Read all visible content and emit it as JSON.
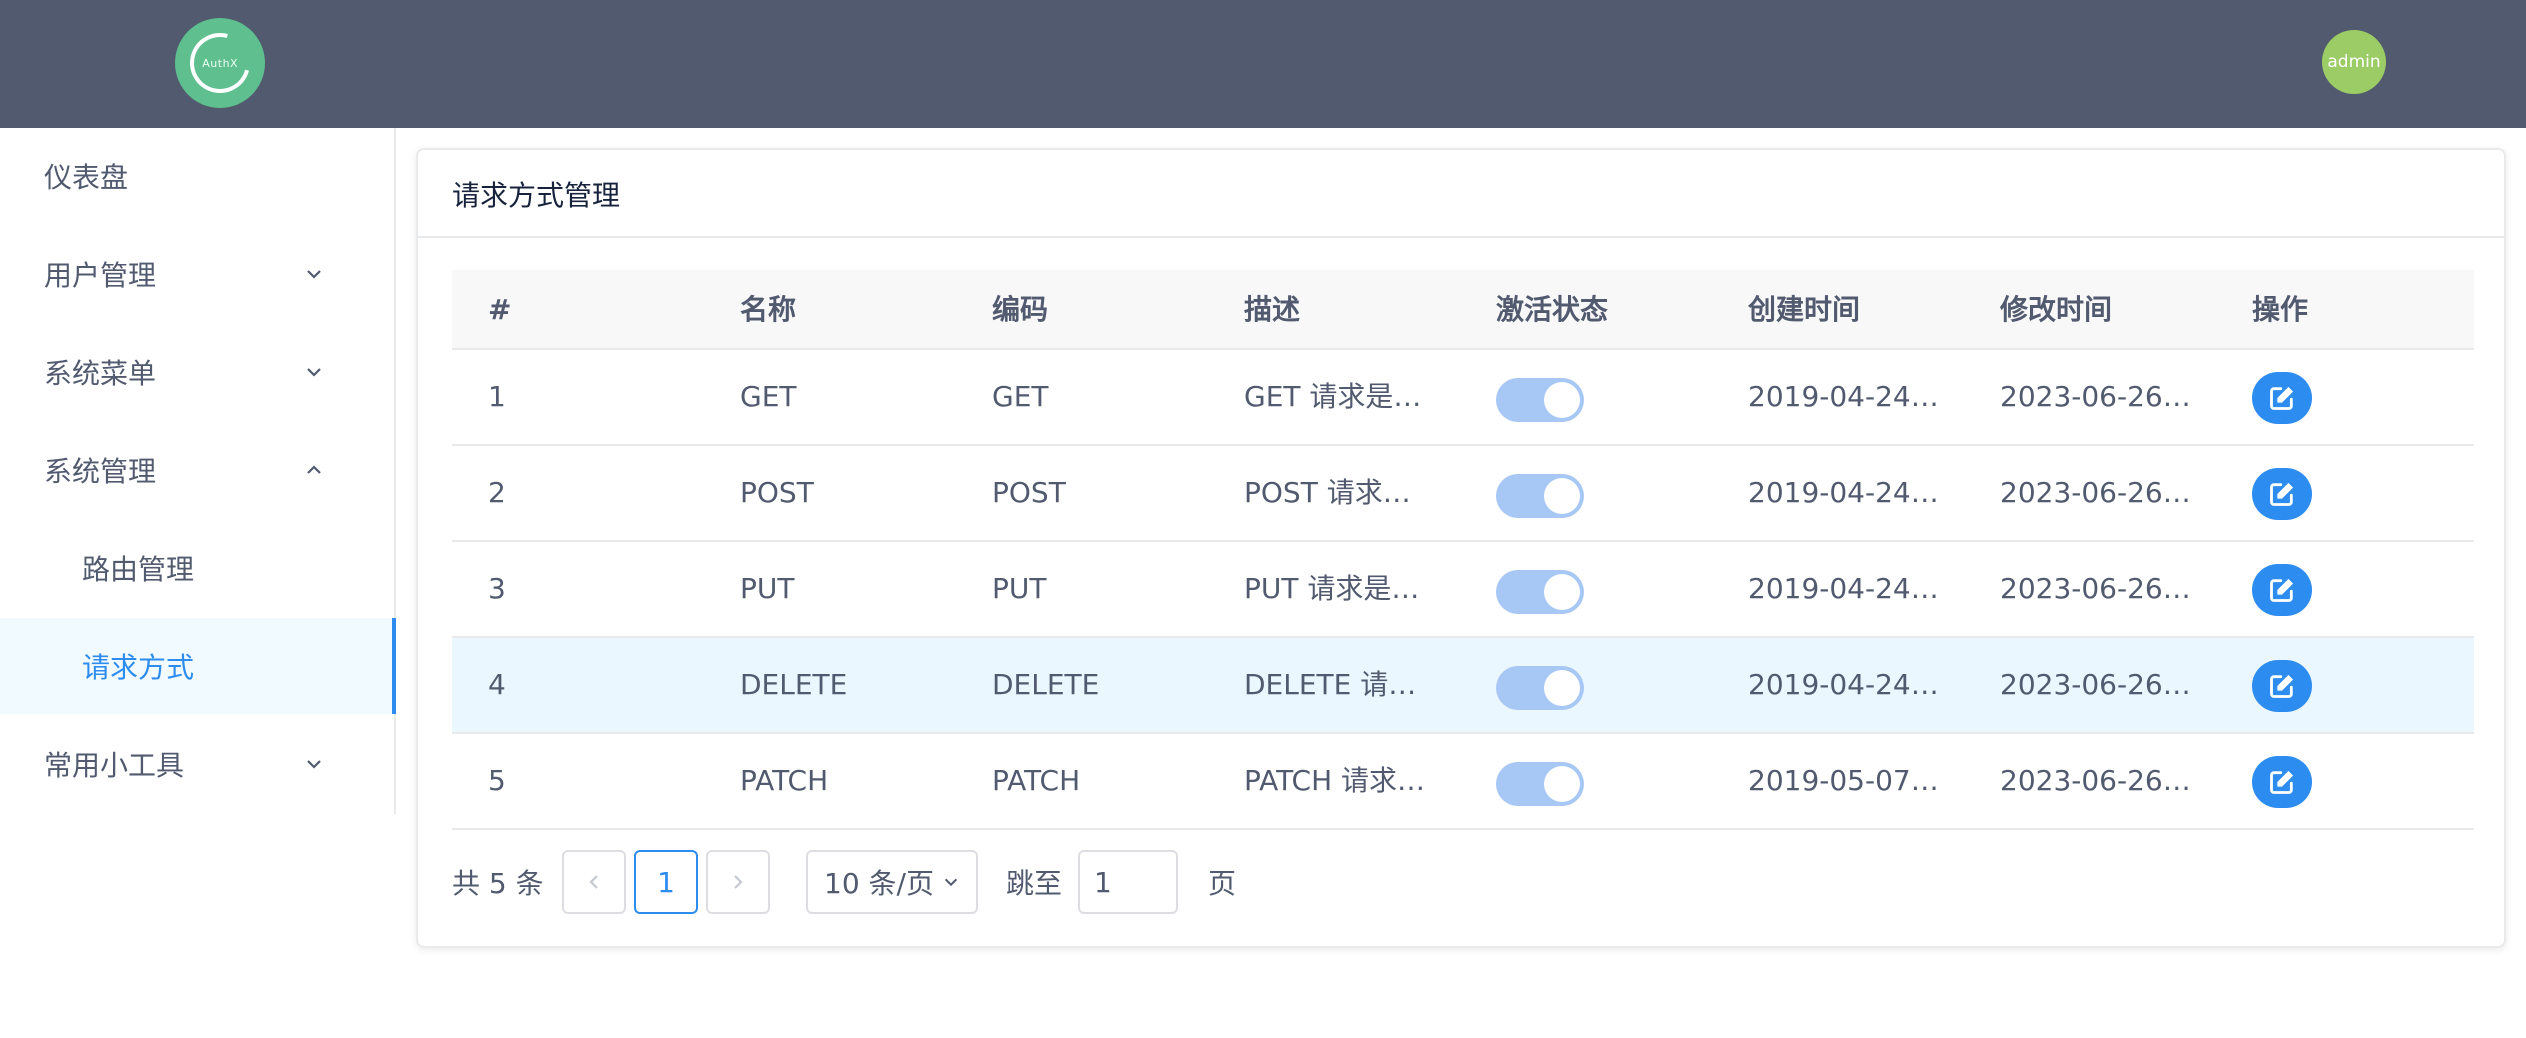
{
  "header": {
    "logo_text": "AuthX",
    "avatar_text": "admin"
  },
  "sidebar": {
    "items": [
      {
        "label": "仪表盘"
      },
      {
        "label": "用户管理"
      },
      {
        "label": "系统菜单"
      },
      {
        "label": "系统管理"
      },
      {
        "label": "路由管理"
      },
      {
        "label": "请求方式"
      },
      {
        "label": "常用小工具"
      }
    ]
  },
  "card": {
    "title": "请求方式管理"
  },
  "table": {
    "headers": [
      "#",
      "名称",
      "编码",
      "描述",
      "激活状态",
      "创建时间",
      "修改时间",
      "操作"
    ],
    "rows": [
      {
        "id": "1",
        "name": "GET",
        "code": "GET",
        "desc": "GET 请求是…",
        "active": true,
        "created": "2019-04-24…",
        "modified": "2023-06-26…"
      },
      {
        "id": "2",
        "name": "POST",
        "code": "POST",
        "desc": "POST 请求…",
        "active": true,
        "created": "2019-04-24…",
        "modified": "2023-06-26…"
      },
      {
        "id": "3",
        "name": "PUT",
        "code": "PUT",
        "desc": "PUT 请求是…",
        "active": true,
        "created": "2019-04-24…",
        "modified": "2023-06-26…"
      },
      {
        "id": "4",
        "name": "DELETE",
        "code": "DELETE",
        "desc": "DELETE 请…",
        "active": true,
        "created": "2019-04-24…",
        "modified": "2023-06-26…"
      },
      {
        "id": "5",
        "name": "PATCH",
        "code": "PATCH",
        "desc": "PATCH 请求…",
        "active": true,
        "created": "2019-05-07…",
        "modified": "2023-06-26…"
      }
    ]
  },
  "pager": {
    "total": "共 5 条",
    "prev_icon": "chevron-left-icon",
    "current_page": "1",
    "next_icon": "chevron-right-icon",
    "page_size": "10 条/页",
    "goto_label": "跳至",
    "goto_value": "1",
    "page_suffix": "页"
  },
  "colors": {
    "header_bg": "#515a6e",
    "accent": "#2d8cf0",
    "logo_bg": "#5fbf8f",
    "avatar_bg": "#9ccc65",
    "toggle_on": "#a7c8f5"
  }
}
